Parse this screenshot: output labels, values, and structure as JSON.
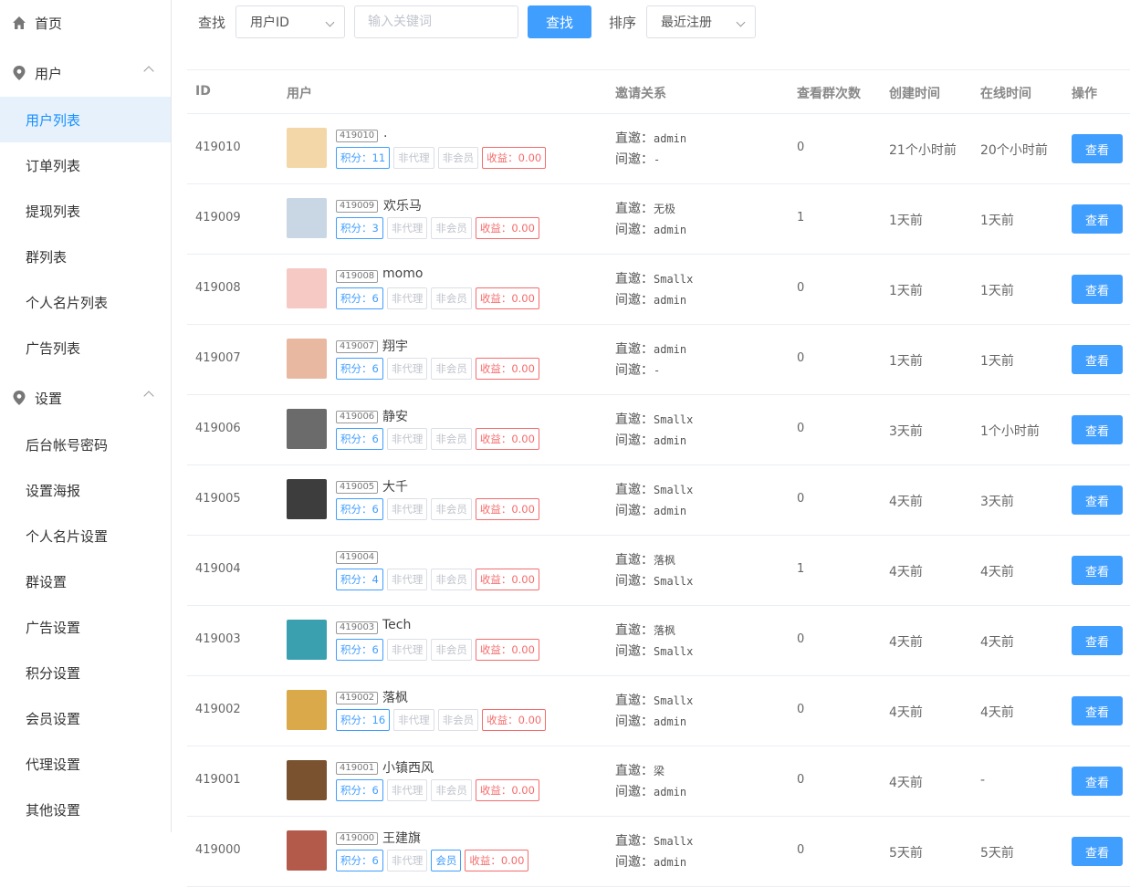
{
  "sidebar": {
    "home": "首页",
    "user_group": "用户",
    "user_items": [
      "用户列表",
      "订单列表",
      "提现列表",
      "群列表",
      "个人名片列表",
      "广告列表"
    ],
    "settings_group": "设置",
    "settings_items": [
      "后台帐号密码",
      "设置海报",
      "个人名片设置",
      "群设置",
      "广告设置",
      "积分设置",
      "会员设置",
      "代理设置",
      "其他设置"
    ]
  },
  "toolbar": {
    "search_label": "查找",
    "field_select": "用户ID",
    "keyword_placeholder": "输入关键词",
    "search_button": "查找",
    "sort_label": "排序",
    "sort_select": "最近注册"
  },
  "table": {
    "headers": [
      "ID",
      "用户",
      "邀请关系",
      "查看群次数",
      "创建时间",
      "在线时间",
      "操作"
    ],
    "direct_label": "直邀：",
    "indirect_label": "间邀：",
    "view_button": "查看",
    "rows": [
      {
        "id": "419010",
        "tag_id": "419010",
        "name": ".",
        "points": "积分：11",
        "agent": "非代理",
        "member": "非会员",
        "income": "收益：0.00",
        "direct": "admin",
        "indirect": "-",
        "views": "0",
        "created": "21个小时前",
        "online": "20个小时前"
      },
      {
        "id": "419009",
        "tag_id": "419009",
        "name": "欢乐马",
        "points": "积分：3",
        "agent": "非代理",
        "member": "非会员",
        "income": "收益：0.00",
        "direct": "无极",
        "indirect": "admin",
        "views": "1",
        "created": "1天前",
        "online": "1天前"
      },
      {
        "id": "419008",
        "tag_id": "419008",
        "name": "momo",
        "points": "积分：6",
        "agent": "非代理",
        "member": "非会员",
        "income": "收益：0.00",
        "direct": "Smallx",
        "indirect": "admin",
        "views": "0",
        "created": "1天前",
        "online": "1天前"
      },
      {
        "id": "419007",
        "tag_id": "419007",
        "name": "翔宇",
        "points": "积分：6",
        "agent": "非代理",
        "member": "非会员",
        "income": "收益：0.00",
        "direct": "admin",
        "indirect": "-",
        "views": "0",
        "created": "1天前",
        "online": "1天前"
      },
      {
        "id": "419006",
        "tag_id": "419006",
        "name": "静安",
        "points": "积分：6",
        "agent": "非代理",
        "member": "非会员",
        "income": "收益：0.00",
        "direct": "Smallx",
        "indirect": "admin",
        "views": "0",
        "created": "3天前",
        "online": "1个小时前"
      },
      {
        "id": "419005",
        "tag_id": "419005",
        "name": "大千",
        "points": "积分：6",
        "agent": "非代理",
        "member": "非会员",
        "income": "收益：0.00",
        "direct": "Smallx",
        "indirect": "admin",
        "views": "0",
        "created": "4天前",
        "online": "3天前"
      },
      {
        "id": "419004",
        "tag_id": "419004",
        "name": "",
        "points": "积分：4",
        "agent": "非代理",
        "member": "非会员",
        "income": "收益：0.00",
        "direct": "落枫",
        "indirect": "Smallx",
        "views": "1",
        "created": "4天前",
        "online": "4天前"
      },
      {
        "id": "419003",
        "tag_id": "419003",
        "name": "Tech",
        "points": "积分：6",
        "agent": "非代理",
        "member": "非会员",
        "income": "收益：0.00",
        "direct": "落枫",
        "indirect": "Smallx",
        "views": "0",
        "created": "4天前",
        "online": "4天前"
      },
      {
        "id": "419002",
        "tag_id": "419002",
        "name": "落枫",
        "points": "积分：16",
        "agent": "非代理",
        "member": "非会员",
        "income": "收益：0.00",
        "direct": "Smallx",
        "indirect": "admin",
        "views": "0",
        "created": "4天前",
        "online": "4天前"
      },
      {
        "id": "419001",
        "tag_id": "419001",
        "name": "小镇西风",
        "points": "积分：6",
        "agent": "非代理",
        "member": "非会员",
        "income": "收益：0.00",
        "direct": "梁",
        "indirect": "admin",
        "views": "0",
        "created": "4天前",
        "online": "-"
      },
      {
        "id": "419000",
        "tag_id": "419000",
        "name": "王建旗",
        "points": "积分：6",
        "agent": "非代理",
        "member": "会员",
        "income": "收益：0.00",
        "direct": "Smallx",
        "indirect": "admin",
        "views": "0",
        "created": "5天前",
        "online": "5天前"
      }
    ]
  },
  "colors": {
    "primary": "#409eff",
    "danger": "#f56c6c",
    "active_bg": "#e6f1fc",
    "muted_border": "#dcdfe6"
  }
}
